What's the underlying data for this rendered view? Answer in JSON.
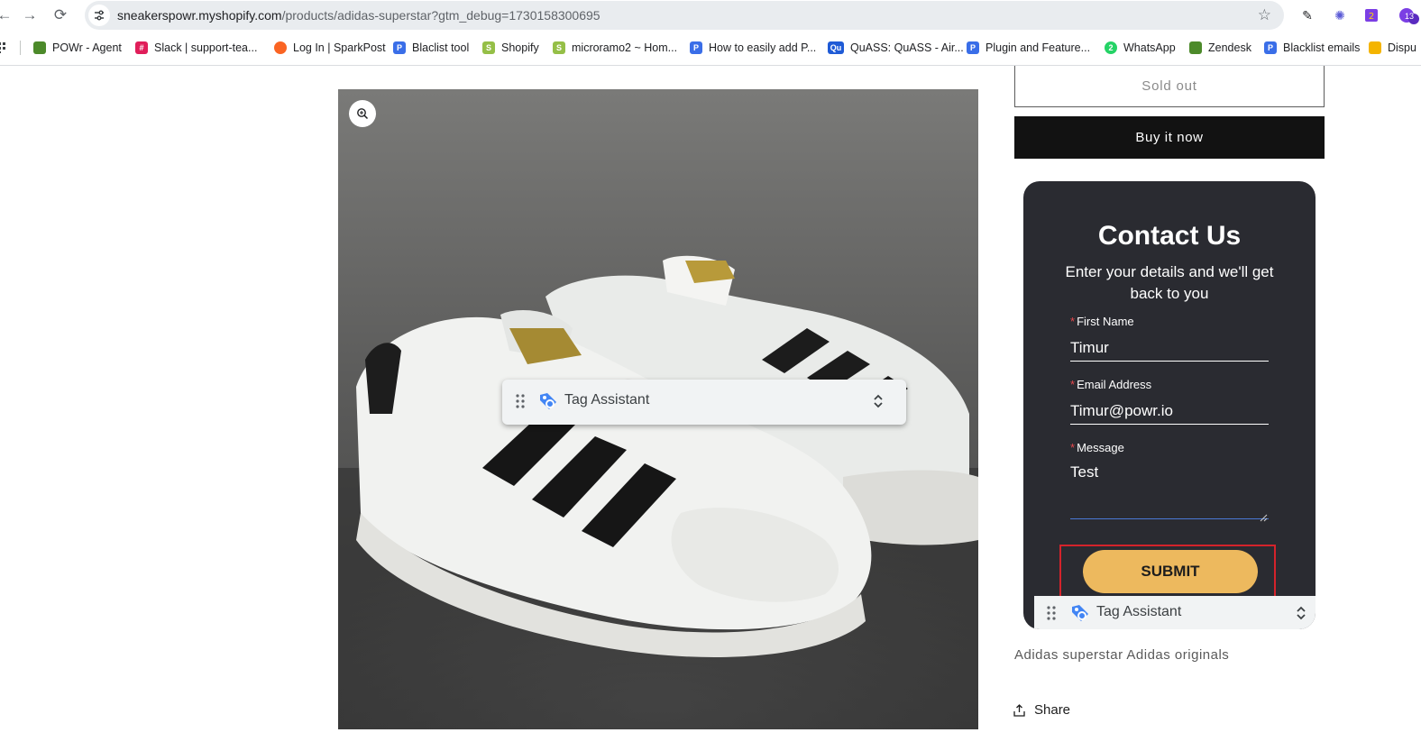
{
  "browser": {
    "url_host": "sneakerspowr.myshopify.com",
    "url_path": "/products/adidas-superstar?gtm_debug=1730158300695",
    "bookmarks": [
      {
        "label": "POWr - Agent",
        "icon": "powr-agent-icon",
        "color": "#4c8a2a"
      },
      {
        "label": "Slack | support-tea...",
        "icon": "slack-icon",
        "color": "#e01e5a"
      },
      {
        "label": "Log In | SparkPost",
        "icon": "sparkpost-icon",
        "color": "#fa6423"
      },
      {
        "label": "Blaclist tool",
        "icon": "powr-icon",
        "color": "#3a6ee8"
      },
      {
        "label": "Shopify",
        "icon": "shopify-icon",
        "color": "#95bf47"
      },
      {
        "label": "microramo2 ~ Hom...",
        "icon": "shopify-icon",
        "color": "#95bf47"
      },
      {
        "label": "How to easily add P...",
        "icon": "powr-icon",
        "color": "#3a6ee8"
      },
      {
        "label": "QuASS: QuASS - Air...",
        "icon": "quass-icon",
        "color": "#1f5bd6"
      },
      {
        "label": "Plugin and Feature...",
        "icon": "powr-icon",
        "color": "#3a6ee8"
      },
      {
        "label": "WhatsApp",
        "icon": "whatsapp-icon",
        "color": "#25d366"
      },
      {
        "label": "Zendesk",
        "icon": "zendesk-icon",
        "color": "#4c8a2a"
      },
      {
        "label": "Blacklist emails",
        "icon": "powr-icon",
        "color": "#3a6ee8"
      },
      {
        "label": "Dispu",
        "icon": "google-drive-icon",
        "color": "#f4b400"
      }
    ],
    "extension_badge": "13"
  },
  "product": {
    "sold_out_label": "Sold out",
    "buy_now_label": "Buy it now",
    "description": "Adidas superstar Adidas originals",
    "share_label": "Share"
  },
  "tag_assistant": {
    "label": "Tag Assistant"
  },
  "contact_form": {
    "title": "Contact Us",
    "subtitle": "Enter your details and we'll get back to you",
    "required_mark": "*",
    "first_name_label": "First Name",
    "first_name_value": "Timur",
    "email_label": "Email Address",
    "email_value": "Timur@powr.io",
    "message_label": "Message",
    "message_value": "Test",
    "submit_label": "SUBMIT"
  },
  "colors": {
    "form_bg": "#2a2b31",
    "submit_bg": "#edb95e",
    "highlight_border": "#d4232b",
    "buy_now_bg": "#121212"
  }
}
